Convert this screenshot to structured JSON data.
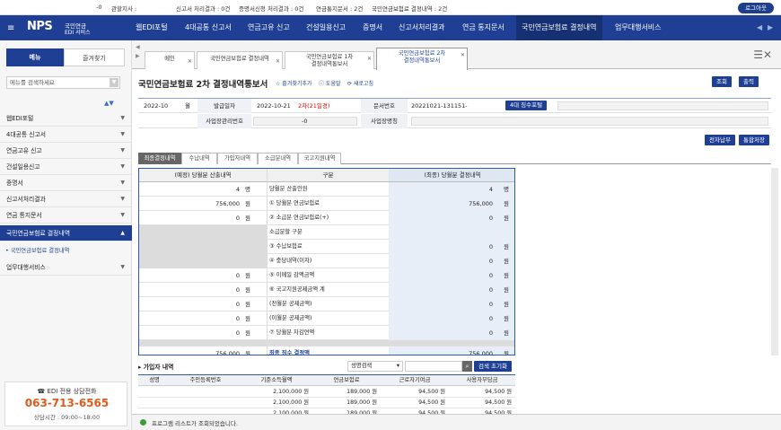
{
  "topbar": {
    "org_suffix": "-0",
    "jurisdiction_label": "관할지사 :",
    "report_result": "신고서 처리결과 : 0건",
    "cert_result": "증명서신청 처리결과 : 0건",
    "notice": "연금통지문서 : 2건",
    "decision": "국민연금보험료 결정내역 : 2건",
    "logout": "로그아웃"
  },
  "logo": {
    "brand": "NPS",
    "line1": "국민연금",
    "line2": "EDI 서비스"
  },
  "nav": {
    "items": [
      "웹EDI포털",
      "4대공통 신고서",
      "연금고유 신고",
      "건설일용신고",
      "증명서",
      "신고서처리결과",
      "연금 통지문서",
      "국민연금보험료 결정내역",
      "업무대행서비스"
    ]
  },
  "sidebar": {
    "tab_menu": "메뉴",
    "tab_fav": "즐겨찾기",
    "search_placeholder": "메뉴를 검색하세요",
    "items": [
      "웹EDI포털",
      "4대공통 신고서",
      "연금고유 신고",
      "건설일용신고",
      "증명서",
      "신고서처리결과",
      "연금 통지문서",
      "국민연금보험료 결정내역",
      "업무대행서비스"
    ],
    "sub_item": "국민연금보험료 결정내역"
  },
  "call": {
    "title": "☎ EDI 전용 상담전화",
    "phone": "063-713-6565",
    "hours": "상담시간 : 09:00~18:00"
  },
  "tabs": [
    {
      "l1": "메인",
      "l2": ""
    },
    {
      "l1": "국민연금보험료 결정내역",
      "l2": ""
    },
    {
      "l1": "국민연금보험료 1차",
      "l2": "결정내역통보서"
    },
    {
      "l1": "국민연금보험료 2차",
      "l2": "결정내역통보서"
    }
  ],
  "page": {
    "title": "국민연금보험료 2차 결정내역통보서",
    "fav": "☆ 즐겨찾기추가",
    "help": "도움말",
    "refresh": "새로고침",
    "btn_search": "조회",
    "btn_print": "출력"
  },
  "info": {
    "month": "2022-10",
    "month_unit": "월",
    "issue_label": "발급일자",
    "issue_date": "2022-10-21",
    "issue_tag": "2차(21일경)",
    "doc_label": "문서번호",
    "doc_no": "20221021-131151-",
    "portal_btn": "4대 징수포털",
    "biz_no_label": "사업장관리번호",
    "biz_no_suffix": "-0",
    "biz_name_label": "사업장명칭"
  },
  "actions": {
    "epay": "전자납부",
    "save": "통합저장"
  },
  "subtabs": [
    "최종결정내역",
    "수납내역",
    "가입자내역",
    "소급분내역",
    "국고지원내역"
  ],
  "grid": {
    "h_left": "(예정) 당월분 산출내역",
    "h_mid": "구분",
    "h_right": "(최종) 당월분 결정내역",
    "rows": [
      {
        "lv": "4",
        "lu": "명",
        "mid": "당월분 산출인원",
        "rv": "4",
        "ru": "명"
      },
      {
        "lv": "756,000",
        "lu": "원",
        "mid": "① 당월분 연금보험료",
        "rv": "756,000",
        "ru": "원"
      },
      {
        "lv": "0",
        "lu": "원",
        "mid": "② 소급분 연금보험료(+)",
        "rv": "0",
        "ru": "원"
      },
      {
        "lv": "",
        "lu": "",
        "mid": "소급분할 구분",
        "rv": "",
        "ru": ""
      },
      {
        "lv": "",
        "lu": "",
        "mid": "③ 수납보험료",
        "rv": "0",
        "ru": "원"
      },
      {
        "lv": "",
        "lu": "",
        "mid": "④ 충당내역(이자)",
        "rv": "0",
        "ru": "원"
      },
      {
        "lv": "0",
        "lu": "원",
        "mid": "⑤ 이메일 감액금액",
        "rv": "0",
        "ru": "원"
      },
      {
        "lv": "0",
        "lu": "원",
        "mid": "⑥ 국고지원공제금액 계",
        "rv": "0",
        "ru": "원"
      },
      {
        "lv": "0",
        "lu": "원",
        "mid": "(전월분 공제금액)",
        "rv": "0",
        "ru": "원"
      },
      {
        "lv": "0",
        "lu": "원",
        "mid": "(이월분 공제금액)",
        "rv": "0",
        "ru": "원"
      },
      {
        "lv": "0",
        "lu": "원",
        "mid": "⑦ 당월분 차감연액",
        "rv": "0",
        "ru": "원"
      }
    ],
    "total": {
      "lv": "756,000",
      "lu": "원",
      "mid": "최종 징수 결정액",
      "rv": "756,000",
      "ru": "원"
    }
  },
  "subscribers": {
    "title": "가입자 내역",
    "search_select": "성명검색",
    "reset": "검색 초기화",
    "headers": [
      "성명",
      "주민등록번호",
      "기준소득월액",
      "연금보험료",
      "근로자기여금",
      "사용자부담금"
    ],
    "rows": [
      [
        "",
        "",
        "2,100,000 원",
        "189,000 원",
        "94,500 원",
        "94,500 원"
      ],
      [
        "",
        "",
        "2,100,000 원",
        "189,000 원",
        "94,500 원",
        "94,500 원"
      ],
      [
        "",
        "",
        "2,100,000 원",
        "189,000 원",
        "94,500 원",
        "94,500 원"
      ]
    ]
  },
  "status": {
    "message": "프로그램 리스트가 조회되었습니다."
  }
}
